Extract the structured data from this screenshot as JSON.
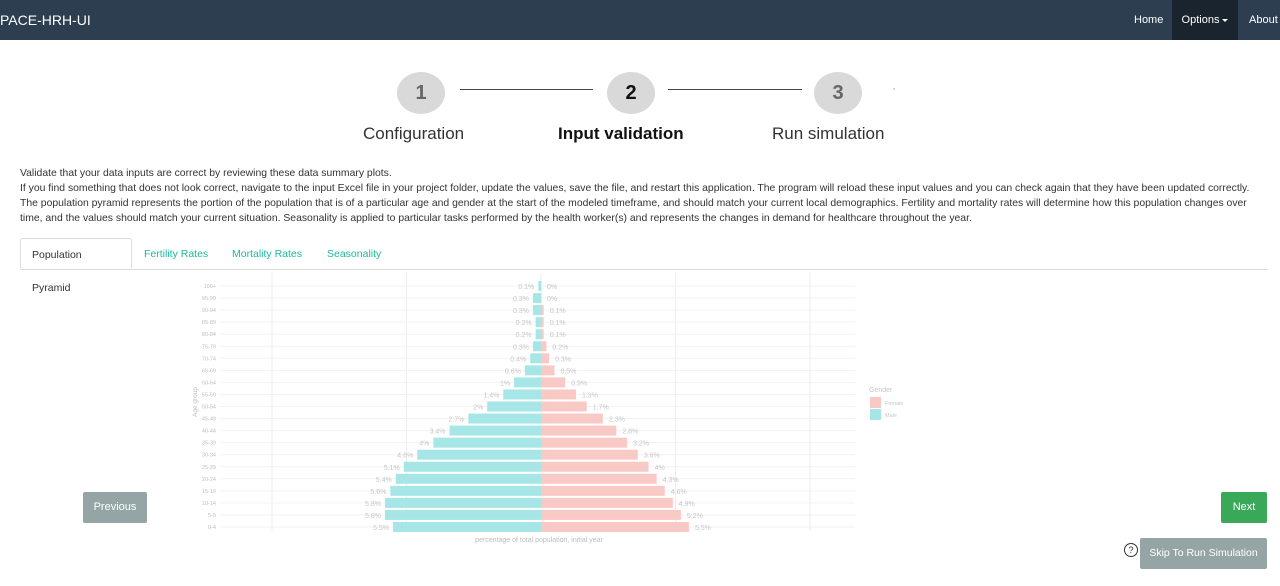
{
  "navbar": {
    "brand": "PACE-HRH-UI",
    "home": "Home",
    "options": "Options",
    "about": "About"
  },
  "steps": [
    {
      "number": "1",
      "label": "Configuration",
      "active": false
    },
    {
      "number": "2",
      "label": "Input validation",
      "active": true
    },
    {
      "number": "3",
      "label": "Run simulation",
      "active": false
    }
  ],
  "intro": {
    "line1": "Validate that your data inputs are correct by reviewing these data summary plots.",
    "line2": "If you find something that does not look correct, navigate to the input Excel file in your project folder, update the values, save the file, and restart this application. The program will reload these input values and you can check again that they have been updated correctly.",
    "line3": "The population pyramid represents the portion of the population that is of a particular age and gender at the start of the modeled timeframe, and should match your current local demographics. Fertility and mortality rates will determine how this population changes over time, and the values should match your current situation. Seasonality is applied to particular tasks performed by the health worker(s) and represents the changes in demand for healthcare throughout the year."
  },
  "tabs": [
    "Population Pyramid",
    "Fertility Rates",
    "Mortality Rates",
    "Seasonality"
  ],
  "buttons": {
    "previous": "Previous",
    "next": "Next",
    "skip": "Skip To Run Simulation",
    "help": "?"
  },
  "colors": {
    "navbar": "#2c3e50",
    "male": "#a6e6e6",
    "female": "#f9c9c5",
    "accent": "#18bc9c",
    "next": "#3aa859",
    "muted_button": "#95a5a6"
  },
  "chart_data": {
    "type": "bar",
    "orientation": "horizontal-pyramid",
    "title": "",
    "xlabel": "percentage of total population, initial year",
    "ylabel": "Age group",
    "categories": [
      "0-4",
      "5-9",
      "10-14",
      "15-19",
      "20-24",
      "25-29",
      "30-34",
      "35-39",
      "40-44",
      "45-49",
      "50-54",
      "55-59",
      "60-64",
      "65-69",
      "70-74",
      "75-79",
      "80-84",
      "85-89",
      "90-94",
      "95-99",
      "100+"
    ],
    "series": [
      {
        "name": "Male",
        "color": "#a6e6e6",
        "values": [
          5.5,
          5.8,
          5.8,
          5.6,
          5.4,
          5.1,
          4.6,
          4,
          3.4,
          2.7,
          2,
          1.4,
          1,
          0.6,
          0.4,
          0.3,
          0.2,
          0.2,
          0.3,
          0.3,
          0.1
        ],
        "labels": [
          "5.5%",
          "5.8%",
          "5.8%",
          "5.6%",
          "5.4%",
          "5.1%",
          "4.6%",
          "4%",
          "3.4%",
          "2.7%",
          "2%",
          "1.4%",
          "1%",
          "0.6%",
          "0.4%",
          "0.3%",
          "0.2%",
          "0.2%",
          "0.3%",
          "0.3%",
          "0.1%"
        ]
      },
      {
        "name": "Female",
        "color": "#f9c9c5",
        "values": [
          5.5,
          5.2,
          4.9,
          4.6,
          4.3,
          4,
          3.6,
          3.2,
          2.8,
          2.3,
          1.7,
          1.3,
          0.9,
          0.5,
          0.3,
          0.2,
          0.1,
          0.1,
          0.1,
          0,
          0
        ],
        "labels": [
          "5.5%",
          "5.2%",
          "4.9%",
          "4.6%",
          "4.3%",
          "4%",
          "3.6%",
          "3.2%",
          "2.8%",
          "2.3%",
          "1.7%",
          "1.3%",
          "0.9%",
          "0.5%",
          "0.3%",
          "0.2%",
          "0.1%",
          "0.1%",
          "0.1%",
          "0%",
          "0%"
        ]
      }
    ],
    "legend": {
      "title": "Gender",
      "entries": [
        "Female",
        "Male"
      ],
      "position": "right"
    },
    "grid": true
  }
}
